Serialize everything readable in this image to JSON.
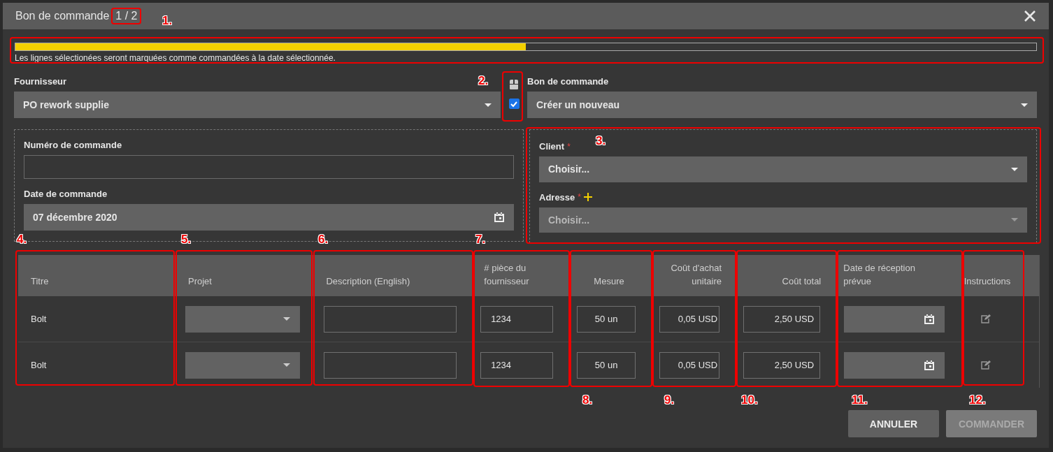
{
  "dialog": {
    "title": "Bon de commande",
    "counter": "1 / 2"
  },
  "progress": {
    "level": 0.5,
    "message": "Les lignes sélectionées seront marquées comme commandées à la date sélectionnée."
  },
  "supplier": {
    "label": "Fournisseur",
    "value": "PO rework supplie"
  },
  "link_checkbox": {
    "checked": true
  },
  "purchase_order": {
    "label": "Bon de commande",
    "value": "Créer un nouveau"
  },
  "order_number": {
    "label": "Numéro de commande"
  },
  "order_date": {
    "label": "Date de commande",
    "value": "07 décembre 2020"
  },
  "client": {
    "label": "Client",
    "required": "*",
    "placeholder": "Choisir..."
  },
  "address": {
    "label": "Adresse",
    "required": "*",
    "placeholder": "Choisir...",
    "disabled": true
  },
  "table": {
    "columns": [
      {
        "label": "Titre"
      },
      {
        "label": "Projet"
      },
      {
        "label": "Description (English)"
      },
      {
        "label": "# pièce du fournisseur"
      },
      {
        "label": "Mesure"
      },
      {
        "label": "Coût d'achat unitaire"
      },
      {
        "label": "Coût total"
      },
      {
        "label": "Date de réception prévue"
      },
      {
        "label": "Instructions"
      }
    ],
    "rows": [
      {
        "title": "Bolt",
        "part": "1234",
        "measure": "50 un",
        "unit_cost": "0,05 USD",
        "total_cost": "2,50 USD"
      },
      {
        "title": "Bolt",
        "part": "1234",
        "measure": "50 un",
        "unit_cost": "0,05 USD",
        "total_cost": "2,50 USD"
      }
    ]
  },
  "buttons": [
    {
      "label": "ANNULER",
      "disabled": false
    },
    {
      "label": "COMMANDER",
      "disabled": true
    }
  ],
  "annotations": [
    {
      "label": "1."
    },
    {
      "label": "2."
    },
    {
      "label": "3."
    },
    {
      "label": "4."
    },
    {
      "label": "5."
    },
    {
      "label": "6."
    },
    {
      "label": "7."
    },
    {
      "label": "8."
    },
    {
      "label": "9."
    },
    {
      "label": "10."
    },
    {
      "label": "11."
    },
    {
      "label": "12."
    }
  ]
}
